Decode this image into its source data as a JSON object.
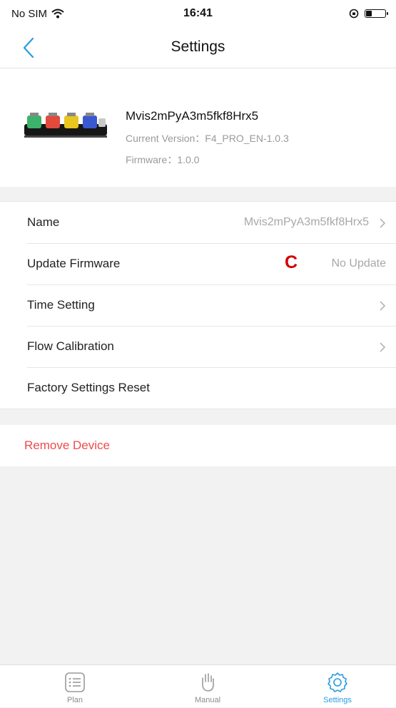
{
  "status_bar": {
    "carrier": "No SIM",
    "time": "16:41"
  },
  "nav": {
    "title": "Settings"
  },
  "device": {
    "name": "Mvis2mPyA3m5fkf8Hrx5",
    "current_version": "Current Version：F4_PRO_EN-1.0.3",
    "firmware": "Firmware：1.0.0"
  },
  "settings": {
    "rows": [
      {
        "label": "Name",
        "value": "Mvis2mPyA3m5fkf8Hrx5"
      },
      {
        "label": "Update Firmware",
        "value": "No Update",
        "marker": "C"
      },
      {
        "label": "Time Setting"
      },
      {
        "label": "Flow Calibration"
      },
      {
        "label": "Factory Settings Reset"
      }
    ]
  },
  "remove_device": {
    "label": "Remove Device"
  },
  "tab_bar": {
    "tabs": [
      {
        "label": "Plan",
        "icon": "list-icon"
      },
      {
        "label": "Manual",
        "icon": "hand-icon"
      },
      {
        "label": "Settings",
        "icon": "gear-icon",
        "active": true
      }
    ]
  },
  "colors": {
    "accent": "#2a9be0",
    "danger": "#ee4b4b",
    "marker": "#d50000",
    "background": "#f2f2f2"
  }
}
